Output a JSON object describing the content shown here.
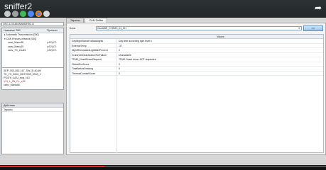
{
  "app": {
    "title": "sniffer2"
  },
  "toolbar_icons": [
    "settings-icon",
    "wrench-icon",
    "refresh-icon",
    "globe-icon",
    "chrome-icon",
    "search-icon",
    "share-icon"
  ],
  "left": {
    "combo_value": "OSC-LOGAN/SANDERO.D",
    "tree": {
      "col1": "Название ЭБУ",
      "col2": "Пронеты",
      "items": [
        {
          "label": "Automatic Transmission [000]",
          "value": ""
        },
        {
          "label": "CAN Primary network [000]",
          "value": ""
        },
        {
          "label": "canv_Manu48",
          "value": "(x52)671"
        },
        {
          "label": "canv_Manu49",
          "value": "(x52)671"
        },
        {
          "label": "canv_TX_ecu45",
          "value": "(x52)671"
        }
      ]
    },
    "devices": [
      "SEP_002-052-167_SW_5I-40-80",
      "TK_YS_BCM_DDT2000_5003_1",
      "PS4TK_ACU_eng_v13",
      "VSI_L_2B_CL_v06",
      "canv_Manu48"
    ],
    "selected_device": 3,
    "actions_header": "Действия",
    "actions_sub": "Экраны"
  },
  "right": {
    "tabs": [
      "Экраны",
      "CAN Sniffer"
    ],
    "ecu_label": "Блок",
    "ecu_value": "Clust2BR_CYRMS_01_SH",
    "go_label": ">>",
    "grid": {
      "values_header": "Values",
      "rows": [
        {
          "name": "DayNightStatusForBacklights",
          "value": "Day time according light level s"
        },
        {
          "name": "ExternalTemp",
          "value": "-37"
        },
        {
          "name": "NightRheostatedLightMaxPercent",
          "value": "0"
        },
        {
          "name": "CruiseCtrlDeactivationForFailure",
          "value": "Unavailable"
        },
        {
          "name": "TPMS_ResetDriverRequest",
          "value": "TPMS Reset driver NOT requested"
        },
        {
          "name": "GlobalEcoScore",
          "value": "0"
        },
        {
          "name": "TimeBeforeDraining",
          "value": "0"
        },
        {
          "name": "ThermalComfortScore",
          "value": "0"
        }
      ]
    }
  },
  "status": {
    "text": "Ожидание CAN"
  },
  "player": {
    "progress": 0.32
  },
  "colors": {
    "accent": "#e52d27",
    "selected_text": "#d11b1b",
    "titlebar": "#2c3134"
  }
}
